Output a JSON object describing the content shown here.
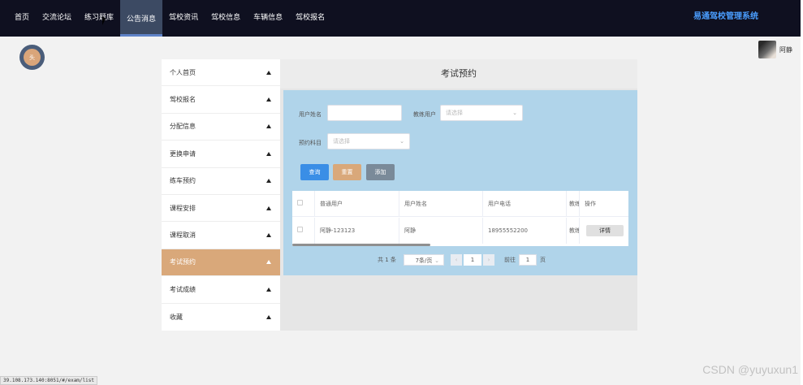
{
  "nav": {
    "items": [
      "首页",
      "交流论坛",
      "练习题库",
      "公告消息",
      "驾校资讯",
      "驾校信息",
      "车辆信息",
      "驾校报名"
    ],
    "active_index": 3,
    "brand": "易通驾校管理系统"
  },
  "user": {
    "name": "阿静",
    "avatar_text": "头"
  },
  "sidebar": {
    "items": [
      {
        "label": "个人首页"
      },
      {
        "label": "驾校报名"
      },
      {
        "label": "分配信息"
      },
      {
        "label": "更换申请"
      },
      {
        "label": "练车预约"
      },
      {
        "label": "课程安排"
      },
      {
        "label": "课程取消"
      },
      {
        "label": "考试预约"
      },
      {
        "label": "考试成绩"
      },
      {
        "label": "收藏"
      }
    ],
    "active_index": 7
  },
  "main": {
    "title": "考试预约",
    "form": {
      "username_label": "用户姓名",
      "username_value": "",
      "coach_label": "教练用户",
      "coach_placeholder": "请选择",
      "subject_label": "预约科目",
      "subject_placeholder": "请选择"
    },
    "buttons": {
      "search": "查询",
      "reset": "重置",
      "add": "添加"
    },
    "table": {
      "columns": [
        "",
        "普通用户",
        "用户姓名",
        "用户电话",
        "教练",
        "操作"
      ],
      "rows": [
        {
          "user": "阿静-123123",
          "name": "阿静",
          "phone": "18955552200",
          "coach": "教练",
          "action": "详情"
        }
      ]
    },
    "pager": {
      "total": "共 1 条",
      "page_size": "7条/页",
      "current": "1",
      "goto_label": "前往",
      "goto_value": "1",
      "page_unit": "页"
    }
  },
  "status_url": "39.108.173.140:8051/#/exam/list",
  "watermark": "CSDN @yuyuxun1",
  "colors": {
    "nav_bg": "#0f1020",
    "brand": "#4a9eff",
    "sidebar_active": "#d9a87a",
    "search_btn": "#3a8ee6",
    "reset_btn": "#d9a87a",
    "add_btn": "#7a8a99",
    "panel_blue": "#b0d4ea"
  }
}
